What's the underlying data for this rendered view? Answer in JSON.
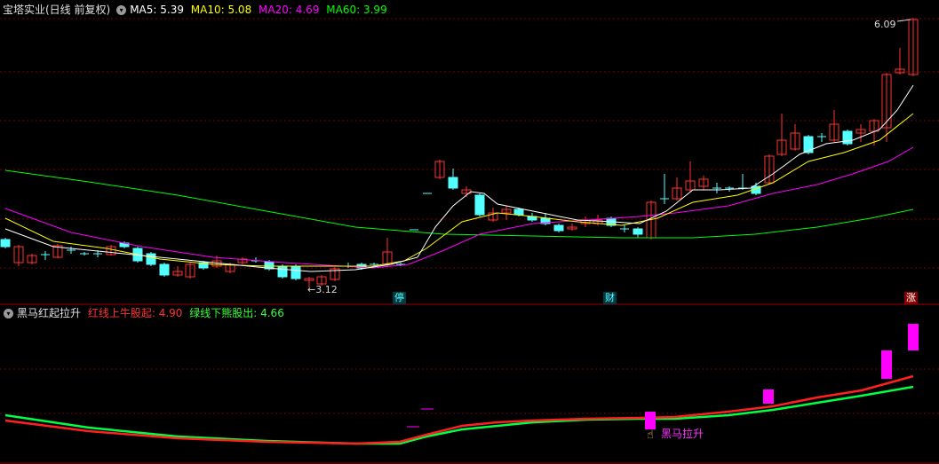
{
  "main_header": {
    "title": "宝塔实业(日线 前复权)",
    "ma5": "MA5: 5.39",
    "ma10": "MA10: 5.08",
    "ma20": "MA20: 4.69",
    "ma60": "MA60: 3.99"
  },
  "indicator_header": {
    "title": "黑马红起拉升",
    "red_line": "红线上牛股起: 4.90",
    "green_line": "绿线下熊股出: 4.66"
  },
  "annotations": {
    "high_price": "6.09",
    "low_price": "←3.12",
    "event_ting": "停",
    "event_cai": "财",
    "event_zhang": "涨",
    "signal_label": "黑马拉升"
  },
  "colors": {
    "up": "#ff3232",
    "down": "#54ffff",
    "ma5": "#ffffff",
    "ma10": "#ffff00",
    "ma20": "#ff00ff",
    "ma60": "#00ff00",
    "grid": "#7a0000",
    "signal": "#ff00ff"
  },
  "icons": {
    "settings_toggle": "chevron-down-icon",
    "cursor": "hand-pointer-icon"
  }
}
